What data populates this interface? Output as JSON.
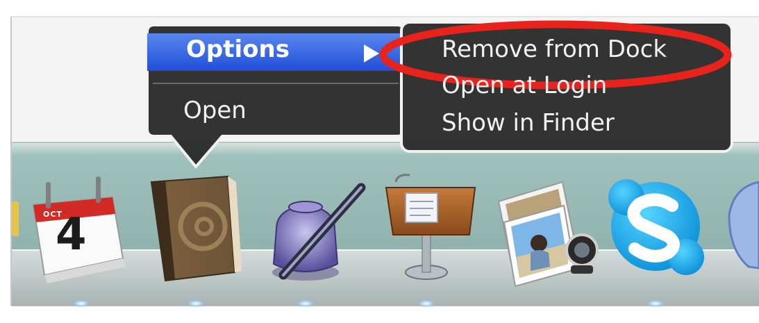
{
  "context_menu": {
    "items": [
      {
        "label": "Options",
        "has_submenu": true,
        "highlighted": true
      },
      {
        "label": "Open",
        "has_submenu": false,
        "highlighted": false
      }
    ]
  },
  "submenu": {
    "items": [
      {
        "label": "Remove from Dock",
        "circled": true
      },
      {
        "label": "Open at Login"
      },
      {
        "label": "Show in Finder"
      }
    ]
  },
  "dock": {
    "apps": [
      {
        "name": "calendar-app-icon",
        "month": "OCT",
        "day": "4"
      },
      {
        "name": "address-book-app-icon"
      },
      {
        "name": "script-editor-app-icon"
      },
      {
        "name": "keynote-app-icon"
      },
      {
        "name": "iphoto-app-icon"
      },
      {
        "name": "skype-app-icon"
      },
      {
        "name": "partial-app-icon"
      }
    ]
  },
  "colors": {
    "menu_bg": "#2b2b2b",
    "highlight": "#2f5de6",
    "annotation": "#e8231b",
    "dock_bg": "#9ab9b4"
  }
}
